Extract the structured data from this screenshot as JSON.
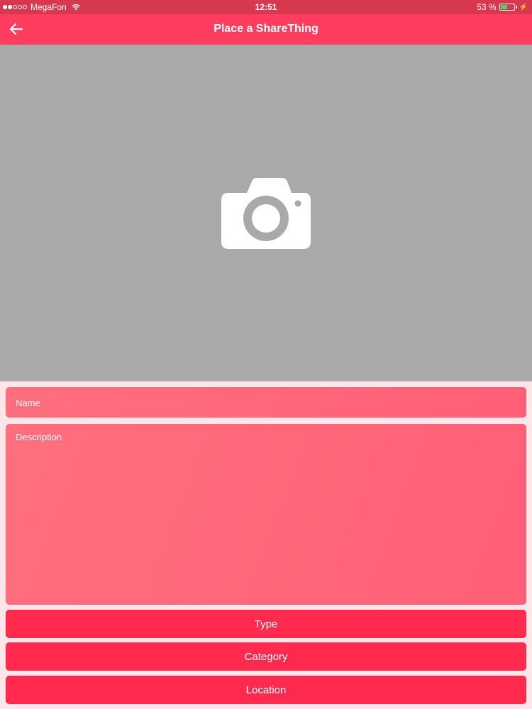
{
  "status_bar": {
    "carrier": "MegaFon",
    "time": "12:51",
    "battery": "53 %",
    "battery_level": 0.53,
    "signal_bars_filled": 2,
    "signal_bars_total": 5
  },
  "nav": {
    "title": "Place a ShareThing",
    "back_icon": "arrow-left-icon"
  },
  "photo": {
    "icon": "camera-icon"
  },
  "form": {
    "name_placeholder": "Name",
    "description_placeholder": "Description",
    "type_label": "Type",
    "category_label": "Category",
    "location_label": "Location"
  },
  "colors": {
    "nav_background": "#ff3d5e",
    "status_background": "#d8384f",
    "photo_background": "#a9a8ab",
    "field_background": "#ff6f7f",
    "button_background": "#ff2a4d"
  }
}
